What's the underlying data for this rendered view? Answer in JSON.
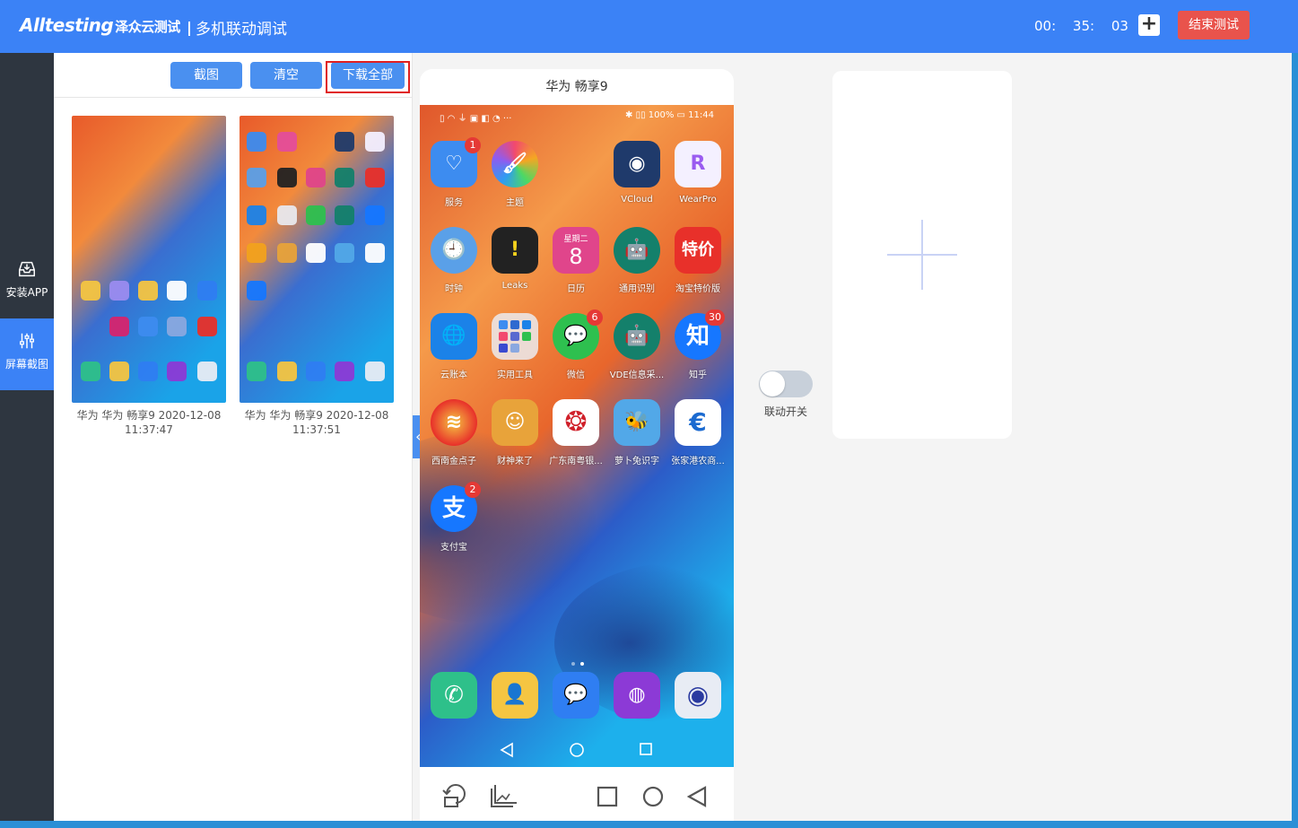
{
  "header": {
    "logo_text": "Alltesting",
    "logo_cn": "泽众云测试",
    "title": "多机联动调试",
    "timer": "00: 35: 03",
    "add_label": "+",
    "end_label": "结束测试"
  },
  "sidebar": {
    "items": [
      {
        "label": "安装APP",
        "icon": "inbox-download-icon"
      },
      {
        "label": "屏幕截图",
        "icon": "sliders-icon"
      }
    ]
  },
  "toolbar": {
    "screenshot_label": "截图",
    "clear_label": "清空",
    "download_all_label": "下载全部"
  },
  "screenshots": [
    {
      "caption": "华为 华为 畅享9 2020-12-08 11:37:47"
    },
    {
      "caption": "华为 华为 畅享9 2020-12-08 11:37:51"
    }
  ],
  "device": {
    "title": "华为 畅享9",
    "status_left": "▯ ◠ ⏚ ▣ ◧ ◔ ···",
    "status_right": "✱ ▯▯ 100% ▭ 11:44",
    "apps": [
      {
        "label": "服务",
        "badge": "1",
        "color": "#3d8cf0"
      },
      {
        "label": "主题",
        "badge": "",
        "color": "#e44d9a"
      },
      {
        "label": "",
        "badge": "",
        "color": ""
      },
      {
        "label": "VCloud",
        "badge": "",
        "color": "#1f3a6b"
      },
      {
        "label": "WearPro",
        "badge": "",
        "color": "#f4f0ff"
      },
      {
        "label": "时钟",
        "badge": "",
        "color": "#5aa0e8"
      },
      {
        "label": "Leaks",
        "badge": "",
        "color": "#222222"
      },
      {
        "label": "日历",
        "badge": "",
        "color": "#e0458b"
      },
      {
        "label": "通用识别",
        "badge": "",
        "color": "#14806b"
      },
      {
        "label": "淘宝特价版",
        "badge": "",
        "color": "#e8302a"
      },
      {
        "label": "云账本",
        "badge": "",
        "color": "#1b82e8"
      },
      {
        "label": "实用工具",
        "badge": "",
        "color": "#e8e8ee"
      },
      {
        "label": "微信",
        "badge": "6",
        "color": "#2ec04f"
      },
      {
        "label": "VDE信息采...",
        "badge": "",
        "color": "#14806b"
      },
      {
        "label": "知乎",
        "badge": "30",
        "color": "#1677ff"
      },
      {
        "label": "西南金点子",
        "badge": "",
        "color": "#f3a21d"
      },
      {
        "label": "财神来了",
        "badge": "",
        "color": "#e8a33a"
      },
      {
        "label": "广东南粤银...",
        "badge": "",
        "color": "#ffffff"
      },
      {
        "label": "萝卜兔识字",
        "badge": "",
        "color": "#52a8e8"
      },
      {
        "label": "张家港农商...",
        "badge": "",
        "color": "#ffffff"
      },
      {
        "label": "支付宝",
        "badge": "2",
        "color": "#1677ff"
      }
    ],
    "calendar_weekday": "星期二",
    "calendar_day": "8",
    "taobao_text": "特价",
    "zhihu_text": "知",
    "alipay_text": "支",
    "dock": [
      {
        "icon": "phone-icon",
        "color": "#2ec08a"
      },
      {
        "icon": "contacts-icon",
        "color": "#f5c542"
      },
      {
        "icon": "messages-icon",
        "color": "#2f7ef2"
      },
      {
        "icon": "browser-icon",
        "color": "#8c3ad6"
      },
      {
        "icon": "camera-icon",
        "color": "#e8ecf4"
      }
    ]
  },
  "sync": {
    "label": "联动开关",
    "enabled": false
  }
}
